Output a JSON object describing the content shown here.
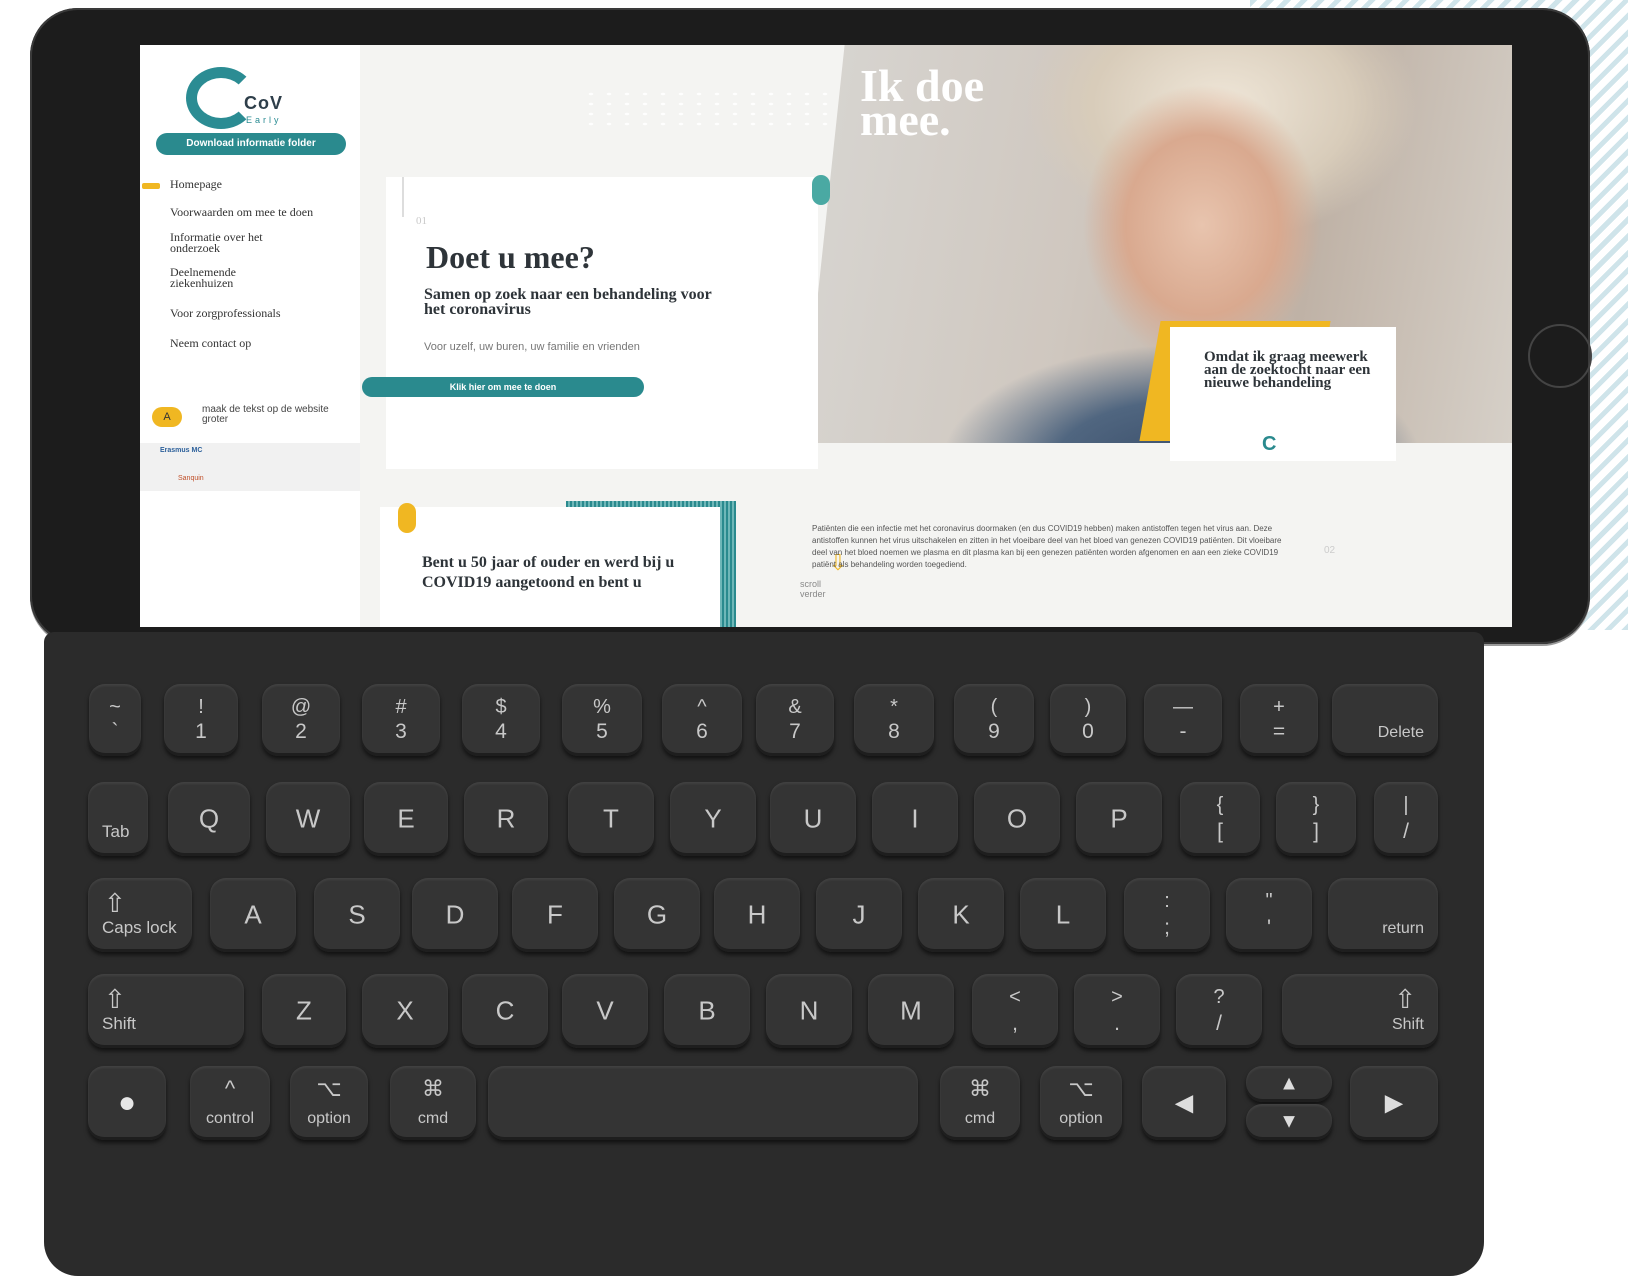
{
  "sidebar": {
    "logo_text": "CoV",
    "logo_sub": "Early",
    "download_button": "Download informatie folder",
    "nav": [
      "Homepage",
      "Voorwaarden om mee te doen",
      "Informatie over het onderzoek",
      "Deelnemende ziekenhuizen",
      "Voor zorgprofessionals",
      "Neem contact op"
    ],
    "a11y_icon": "A",
    "a11y_text": "maak de tekst op de website groter",
    "partners": [
      "Erasmus MC",
      "Sanquin"
    ]
  },
  "hero": {
    "card_number": "01",
    "title": "Doet u mee?",
    "subtitle": "Samen op zoek naar een behandeling voor het coronavirus",
    "small_text": "Voor uzelf, uw buren, uw familie en vrienden",
    "cta": "Klik hier om mee te doen",
    "scroll_label": "scroll verder",
    "photo_title_line1": "Ik doe",
    "photo_title_line2": "mee.",
    "quote": "Omdat ik graag meewerk aan de zoektocht naar een nieuwe behandeling",
    "quote_logo": "C"
  },
  "section2": {
    "card_text": "Bent u 50 jaar of ouder en werd bij u COVID19 aangetoond en bent u",
    "body_text": "Patiënten die een infectie met het coronavirus doormaken (en dus COVID19 hebben) maken antistoffen tegen het virus aan. Deze antistoffen kunnen het virus uitschakelen en zitten in het vloeibare deel van het bloed van genezen COVID19 patiënten. Dit vloeibare deel van het bloed noemen we plasma en dit plasma kan bij een genezen patiënten worden afgenomen en aan een zieke COVID19 patiënt als behandeling worden toegediend.",
    "number": "02"
  },
  "keyboard": {
    "row1": [
      {
        "top": "~",
        "bot": "`"
      },
      {
        "top": "!",
        "bot": "1"
      },
      {
        "top": "@",
        "bot": "2"
      },
      {
        "top": "#",
        "bot": "3"
      },
      {
        "top": "$",
        "bot": "4"
      },
      {
        "top": "%",
        "bot": "5"
      },
      {
        "top": "^",
        "bot": "6"
      },
      {
        "top": "&",
        "bot": "7"
      },
      {
        "top": "*",
        "bot": "8"
      },
      {
        "top": "(",
        "bot": "9"
      },
      {
        "top": ")",
        "bot": "0"
      },
      {
        "top": "—",
        "bot": "-"
      },
      {
        "top": "+",
        "bot": "="
      }
    ],
    "delete": "Delete",
    "tab": "Tab",
    "row2": [
      "Q",
      "W",
      "E",
      "R",
      "T",
      "Y",
      "U",
      "I",
      "O",
      "P"
    ],
    "row2_sym": [
      {
        "top": "{",
        "bot": "["
      },
      {
        "top": "}",
        "bot": "]"
      },
      {
        "top": "|",
        "bot": "/"
      }
    ],
    "caps": "Caps lock",
    "row3": [
      "A",
      "S",
      "D",
      "F",
      "G",
      "H",
      "J",
      "K",
      "L"
    ],
    "row3_sym": [
      {
        "top": ":",
        "bot": ";"
      },
      {
        "top": "\"",
        "bot": "'"
      }
    ],
    "return": "return",
    "shift": "Shift",
    "row4": [
      "Z",
      "X",
      "C",
      "V",
      "B",
      "N",
      "M"
    ],
    "row4_sym": [
      {
        "top": "<",
        "bot": ","
      },
      {
        "top": ">",
        "bot": "."
      },
      {
        "top": "?",
        "bot": "/"
      }
    ],
    "control": "control",
    "option": "option",
    "cmd": "cmd",
    "icons": {
      "shift": "⇧",
      "control": "^",
      "option": "⌥",
      "cmd": "⌘",
      "left": "◀",
      "right": "▶",
      "up": "▲",
      "down": "▼",
      "globe": "●"
    }
  }
}
